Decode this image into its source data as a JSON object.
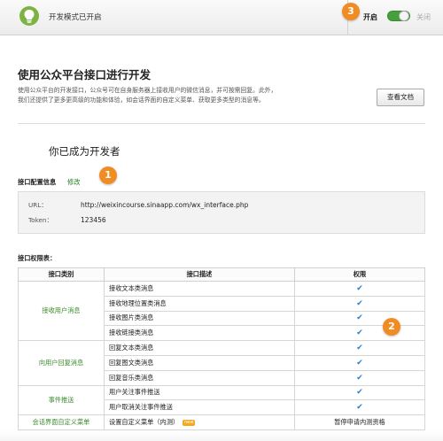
{
  "topbar": {
    "mode_text": "开发模式已开启",
    "on_label": "开启",
    "off_label": "关闭"
  },
  "badges": {
    "one": "1",
    "two": "2",
    "three": "3"
  },
  "main": {
    "title": "使用公众平台接口进行开发",
    "desc_line1": "使用公众平台的开发接口，公众号可在自身服务器上接收用户的微信消息，并可按需回复。此外，",
    "desc_line2": "我们还提供了更多更高级的功能和体验，如会话界面的自定义菜单、获取更多类型的消息等。",
    "doc_button": "查看文档",
    "dev_title": "你已成为开发者"
  },
  "config": {
    "label": "接口配置信息",
    "edit_link": "修改",
    "url_key": "URL：",
    "url_value": "http://weixincourse.sinaapp.com/wx_interface.php",
    "token_key": "Token：",
    "token_value": "123456"
  },
  "permissions": {
    "label": "接口权限表：",
    "headers": [
      "接口类别",
      "接口描述",
      "权限"
    ],
    "check_symbol": "✔",
    "groups": [
      {
        "category": "接收用户消息",
        "rows": [
          "接收文本类消息",
          "接收地理位置类消息",
          "接收图片类消息",
          "接收链接类消息"
        ]
      },
      {
        "category": "向用户回复消息",
        "rows": [
          "回复文本类消息",
          "回复图文类消息",
          "回复音乐类消息"
        ]
      },
      {
        "category": "事件推送",
        "rows": [
          "用户关注事件推送",
          "用户取消关注事件推送"
        ]
      }
    ],
    "last_row": {
      "category": "会话界面自定义菜单",
      "desc": "设置自定义菜单（内测）",
      "tag": "new",
      "perm": "暂停申请内测资格"
    }
  },
  "colors": {
    "accent_green": "#45a03b",
    "badge_orange": "#f08c23",
    "check_blue": "#2a7fd4"
  }
}
